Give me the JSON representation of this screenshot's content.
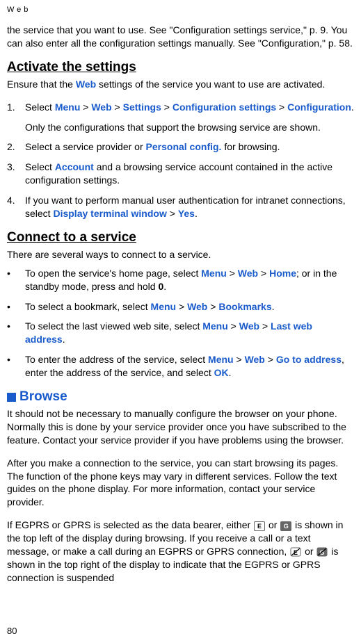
{
  "header": "Web",
  "intro": {
    "prefix": "the service that you want to use. See \"Configuration settings service,\" p. 9. You can also enter all the configuration settings manually. See \"Configuration,\" p. 58."
  },
  "section1": {
    "heading": "Activate the settings",
    "intro_before": "Ensure that the ",
    "intro_web": "Web",
    "intro_after": " settings of the service you want to use are activated.",
    "item1": {
      "num": "1.",
      "before": "Select ",
      "menu": "Menu",
      "gt1": " > ",
      "web": "Web",
      "gt2": " > ",
      "settings": "Settings",
      "gt3": " > ",
      "config_sett": "Configuration settings",
      "gt4": " > ",
      "config": "Configuration",
      "after": ".",
      "sub": "Only the configurations that support the browsing service are shown."
    },
    "item2": {
      "num": "2.",
      "before": "Select a service provider or ",
      "personal": "Personal config.",
      "after": " for browsing."
    },
    "item3": {
      "num": "3.",
      "before": "Select ",
      "account": "Account",
      "after": " and a browsing service account contained in the active configuration settings."
    },
    "item4": {
      "num": "4.",
      "before": "If you want to perform manual user authentication for intranet connections, select ",
      "dtw": "Display terminal window",
      "gt": " > ",
      "yes": "Yes",
      "after": "."
    }
  },
  "section2": {
    "heading": "Connect to a service",
    "intro": "There are several ways to connect to a service.",
    "b1": {
      "before": "To open the service's home page, select ",
      "menu": "Menu",
      "gt1": " > ",
      "web": "Web",
      "gt2": " > ",
      "home": "Home",
      "mid": "; or in the standby mode, press and hold ",
      "key": "0",
      "after": "."
    },
    "b2": {
      "before": "To select a bookmark, select ",
      "menu": "Menu",
      "gt1": " > ",
      "web": "Web",
      "gt2": " > ",
      "bookmarks": "Bookmarks",
      "after": "."
    },
    "b3": {
      "before": "To select the last viewed web site, select ",
      "menu": "Menu",
      "gt1": " > ",
      "web": "Web",
      "gt2": " > ",
      "lastweb": "Last web address",
      "after": "."
    },
    "b4": {
      "before": "To enter the address of the service, select ",
      "menu": "Menu",
      "gt1": " > ",
      "web": "Web",
      "gt2": " > ",
      "goto": "Go to address",
      "mid": ", enter the address of the service, and select ",
      "ok": "OK",
      "after": "."
    }
  },
  "section3": {
    "heading": "Browse",
    "p1": "It should not be necessary to manually configure the browser on your phone. Normally this is done by your service provider once you have subscribed to the feature. Contact your service provider if you have problems using the browser.",
    "p2": "After you make a connection to the service, you can start browsing its pages. The function of the phone keys may vary in different services. Follow the text guides on the phone display. For more information, contact your service provider.",
    "p3_a": "If EGPRS or GPRS is selected as the data bearer, either ",
    "p3_b": " or ",
    "p3_c": " is shown in the top left of the display during browsing. If you receive a call or a text message, or make a call during an EGPRS or GPRS connection, ",
    "p3_d": " or ",
    "p3_e": " is shown in the top right of the display to indicate that the EGPRS or GPRS connection is suspended"
  },
  "icon_e": "E",
  "icon_g": "G",
  "page": "80"
}
